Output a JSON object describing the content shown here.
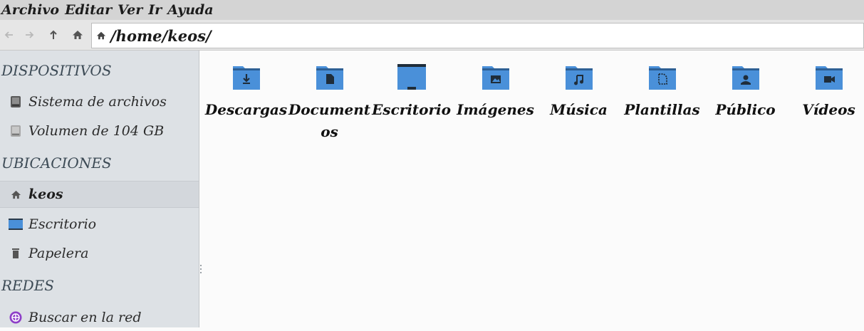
{
  "menu": {
    "items": [
      "Archivo",
      "Editar",
      "Ver",
      "Ir",
      "Ayuda"
    ]
  },
  "toolbar": {
    "back_icon": "arrow-left-icon",
    "forward_icon": "arrow-right-icon",
    "up_icon": "arrow-up-icon",
    "home_icon": "home-icon",
    "location_path": "/home/keos/"
  },
  "sidebar": {
    "sections": {
      "devices": "DISPOSITIVOS",
      "places": "UBICACIONES",
      "networks": "REDES"
    },
    "devices": [
      {
        "label": "Sistema de archivos",
        "icon": "drive-icon"
      },
      {
        "label": "Volumen de 104 GB",
        "icon": "drive-removable-icon"
      }
    ],
    "places": [
      {
        "label": "keos",
        "icon": "home-icon",
        "selected": true
      },
      {
        "label": "Escritorio",
        "icon": "desktop-icon"
      },
      {
        "label": "Papelera",
        "icon": "trash-icon"
      }
    ],
    "networks": [
      {
        "label": "Buscar en la red",
        "icon": "network-icon"
      }
    ]
  },
  "files": [
    {
      "name": "Descargas",
      "icon": "folder-download-icon"
    },
    {
      "name": "Documentos",
      "icon": "folder-documents-icon"
    },
    {
      "name": "Escritorio",
      "icon": "folder-desktop-icon"
    },
    {
      "name": "Imágenes",
      "icon": "folder-pictures-icon"
    },
    {
      "name": "Música",
      "icon": "folder-music-icon"
    },
    {
      "name": "Plantillas",
      "icon": "folder-templates-icon"
    },
    {
      "name": "Público",
      "icon": "folder-public-icon"
    },
    {
      "name": "Vídeos",
      "icon": "folder-videos-icon"
    }
  ],
  "colors": {
    "folder_blue": "#4a90d9",
    "folder_dark": "#2d5f94",
    "sidebar_bg": "#dde1e5",
    "menubar_bg": "#d4d4d4"
  }
}
